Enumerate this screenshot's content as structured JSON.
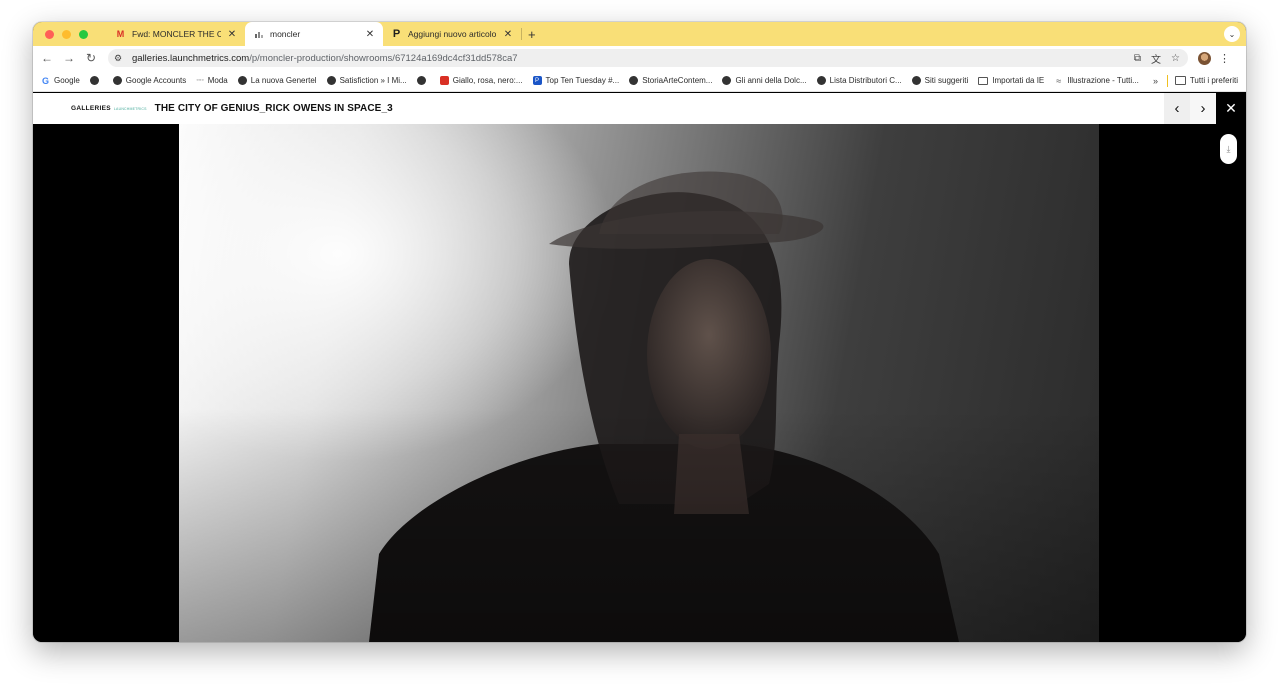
{
  "browser": {
    "tabs": [
      {
        "title": "Fwd: MONCLER THE CITY OF GENIUS",
        "icon": "gmail-icon",
        "active": false
      },
      {
        "title": "moncler",
        "icon": "launchmetrics-icon",
        "active": true
      },
      {
        "title": "Aggiungi nuovo articolo ‹ Pos",
        "icon": "p-icon",
        "active": false
      }
    ],
    "new_tab": "+",
    "tab_menu": "⌄",
    "url_host": "galleries.launchmetrics.com",
    "url_path": "/p/moncler-production/showrooms/67124a169dc4cf31dd578ca7"
  },
  "bookmarks": {
    "items": [
      {
        "label": "Google",
        "icon": "google-icon"
      },
      {
        "label": "",
        "icon": "globe-icon"
      },
      {
        "label": "Google Accounts",
        "icon": "globe-icon"
      },
      {
        "label": "Moda",
        "icon": "dots-icon"
      },
      {
        "label": "La nuova Genertel",
        "icon": "globe-icon"
      },
      {
        "label": "Satisfiction » I Mi...",
        "icon": "globe-icon"
      },
      {
        "label": "",
        "icon": "globe-icon"
      },
      {
        "label": "Giallo, rosa, nero:...",
        "icon": "news-icon"
      },
      {
        "label": "Top Ten Tuesday #...",
        "icon": "p-blue-icon"
      },
      {
        "label": "StoriaArteContem...",
        "icon": "globe-icon"
      },
      {
        "label": "Gli anni della Dolc...",
        "icon": "globe-icon"
      },
      {
        "label": "Lista Distributori C...",
        "icon": "globe-icon"
      },
      {
        "label": "Siti suggeriti",
        "icon": "globe-icon"
      },
      {
        "label": "Importati da IE",
        "icon": "folder-icon"
      },
      {
        "label": "Illustrazione - Tutti...",
        "icon": "wave-icon"
      }
    ],
    "more": "»",
    "all_bookmarks": "Tutti i preferiti"
  },
  "gallery": {
    "logo": "GALLERIES",
    "logo_sub": "LAUNCHMETRICS",
    "title": "THE CITY OF GENIUS_RICK OWENS IN SPACE_3",
    "prev": "‹",
    "next": "›",
    "close": "✕",
    "download": "⤓"
  }
}
